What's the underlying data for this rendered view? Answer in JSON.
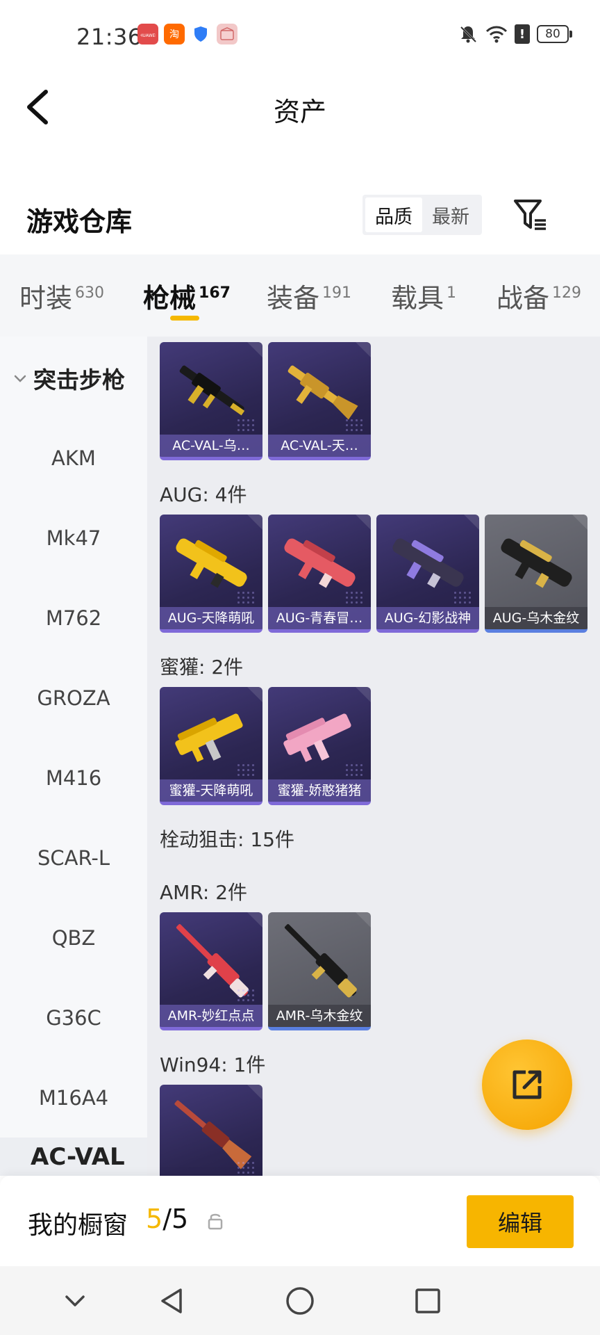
{
  "status_bar": {
    "time": "21:36",
    "apps": [
      {
        "name": "huawei-app-icon",
        "label": "HUAWEI"
      },
      {
        "name": "taobao-app-icon",
        "label": "淘"
      },
      {
        "name": "shield-app-icon",
        "label": ""
      },
      {
        "name": "box-app-icon",
        "label": ""
      }
    ],
    "battery": "80"
  },
  "app_bar": {
    "title": "资产"
  },
  "warehouse": {
    "title": "游戏仓库",
    "sort_options": [
      "品质",
      "最新"
    ],
    "active_sort": "品质"
  },
  "tabs": [
    {
      "label": "时装",
      "count": "630"
    },
    {
      "label": "枪械",
      "count": "167",
      "active": true
    },
    {
      "label": "装备",
      "count": "191"
    },
    {
      "label": "载具",
      "count": "1"
    },
    {
      "label": "战备",
      "count": "129"
    }
  ],
  "sidebar": {
    "group": "突击步枪",
    "items": [
      "AKM",
      "Mk47",
      "M762",
      "GROZA",
      "M416",
      "SCAR-L",
      "QBZ",
      "G36C",
      "M16A4"
    ],
    "lower_item": "AC-VAL"
  },
  "content": {
    "sections": [
      {
        "label": "",
        "items": [
          {
            "caption": "AC-VAL-乌…",
            "style": "purple",
            "accent": "#d8b02a"
          },
          {
            "caption": "AC-VAL-天…",
            "style": "purple",
            "accent": "#e3b23a"
          }
        ]
      },
      {
        "label": "AUG: 4件",
        "items": [
          {
            "caption": "AUG-天降萌吼",
            "style": "purple",
            "accent": "#f2c21b"
          },
          {
            "caption": "AUG-青春冒…",
            "style": "purple",
            "accent": "#e55a63"
          },
          {
            "caption": "AUG-幻影战神",
            "style": "purple",
            "accent": "#8f7be0"
          },
          {
            "caption": "AUG-乌木金纹",
            "style": "gray",
            "accent": "#d9b347"
          }
        ]
      },
      {
        "label": "蜜獾: 2件",
        "items": [
          {
            "caption": "蜜獾-天降萌吼",
            "style": "purple",
            "accent": "#f2c21b"
          },
          {
            "caption": "蜜獾-娇憨猪猪",
            "style": "purple",
            "accent": "#f2a6c4"
          }
        ]
      },
      {
        "label": "栓动狙击: 15件",
        "items": []
      },
      {
        "label": "AMR: 2件",
        "items": [
          {
            "caption": "AMR-妙红点点",
            "style": "purple",
            "accent": "#e0414a"
          },
          {
            "caption": "AMR-乌木金纹",
            "style": "gray",
            "accent": "#d9b347"
          }
        ]
      },
      {
        "label": "Win94: 1件",
        "items": [
          {
            "caption": "",
            "style": "purple",
            "accent": "#b84a3a"
          }
        ]
      }
    ]
  },
  "showcase": {
    "label": "我的橱窗",
    "current": "5",
    "separator": "/",
    "total": "5",
    "edit_label": "编辑"
  },
  "colors": {
    "accent": "#f5b800",
    "card_purple": "#2c2652",
    "card_gray": "#52535b"
  }
}
